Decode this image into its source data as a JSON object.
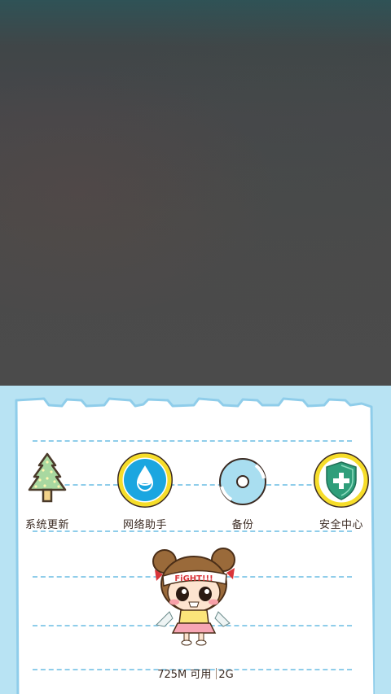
{
  "apps": [
    {
      "label": "系统更新",
      "icon": "tree-icon"
    },
    {
      "label": "网络助手",
      "icon": "water-drop-icon"
    },
    {
      "label": "备份",
      "icon": "disc-icon"
    },
    {
      "label": "安全中心",
      "icon": "shield-plus-icon"
    }
  ],
  "mascot": {
    "headband_text": "FiGHT!!!"
  },
  "memory": {
    "available": "725M 可用",
    "total": "2G"
  },
  "colors": {
    "panel_bg": "#b8e3f3",
    "paper": "#ffffff",
    "paper_border": "#8fcdea",
    "dash_line": "#8fcdea",
    "tree_green": "#a8d8a0",
    "ring_yellow": "#f6dd2a",
    "drop_blue": "#1ba6e0",
    "disc_blue": "#a9def0",
    "shield_green": "#2f9e7a",
    "label_text": "#3a2a22"
  }
}
